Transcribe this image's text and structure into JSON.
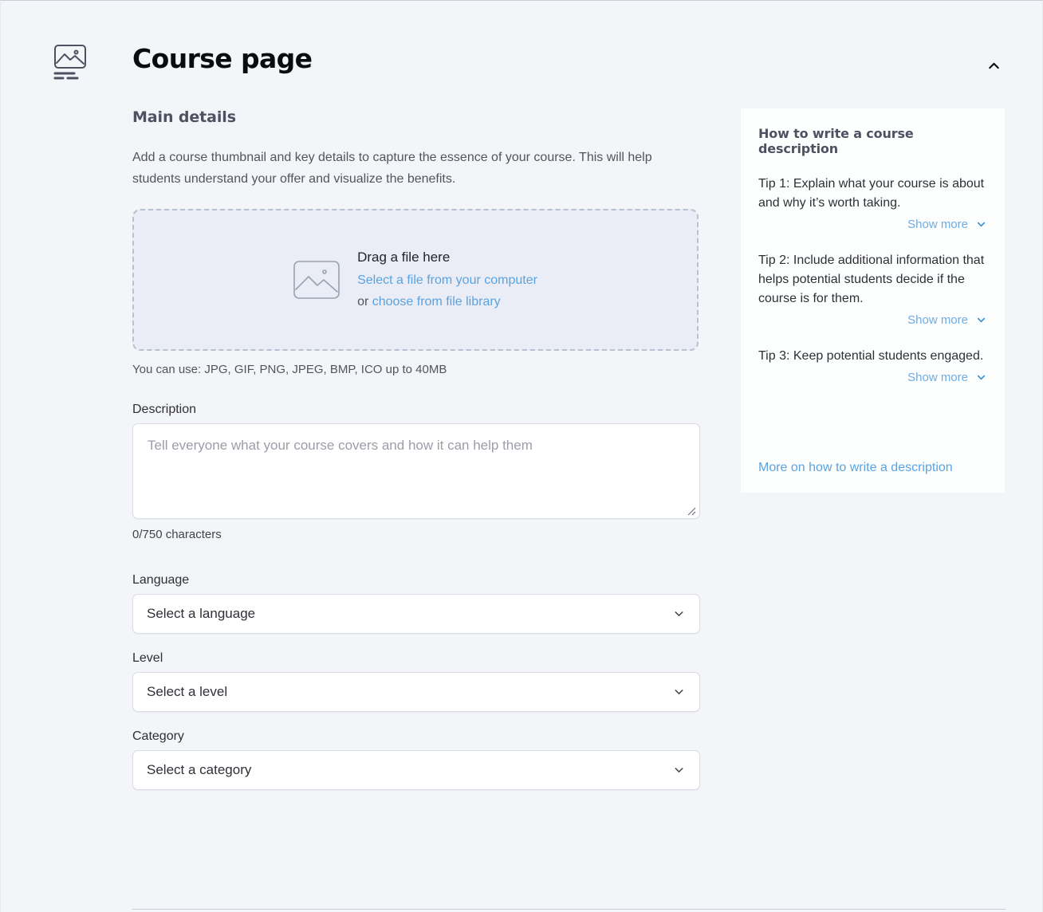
{
  "header": {
    "icon": "image-with-lines-icon",
    "title": "Course page",
    "collapse_icon": "chevron-up-icon"
  },
  "main": {
    "section_title": "Main details",
    "section_description": "Add a course thumbnail and key details to capture the essence of your course. This will help students understand your offer and visualize the benefits.",
    "dropzone": {
      "icon": "image-placeholder-icon",
      "title": "Drag a file here",
      "link_primary": "Select a file from your computer",
      "or_prefix": "or ",
      "link_secondary": "choose from file library",
      "hint": "You can use: JPG, GIF, PNG, JPEG, BMP, ICO up to 40MB"
    },
    "description": {
      "label": "Description",
      "placeholder": "Tell everyone what your course covers and how it can help them",
      "value": "",
      "char_count": "0/750 characters"
    },
    "fields": [
      {
        "label": "Language",
        "value": "Select a language",
        "caret": "chevron-down-icon"
      },
      {
        "label": "Level",
        "value": "Select a level",
        "caret": "chevron-down-icon"
      },
      {
        "label": "Category",
        "value": "Select a category",
        "caret": "chevron-down-icon"
      }
    ]
  },
  "tips": {
    "title": "How to write a course description",
    "items": [
      {
        "text": "Tip 1: Explain what your course is about and why it’s worth taking.",
        "show_more": "Show more"
      },
      {
        "text": "Tip 2: Include additional information that helps potential students decide if the course is for them.",
        "show_more": "Show more"
      },
      {
        "text": "Tip 3: Keep potential students engaged.",
        "show_more": "Show more"
      }
    ],
    "footer_link": "More on how to write a description"
  },
  "colors": {
    "background": "#f4f5f9",
    "card": "#fdfefe",
    "link": "#5ba3e0",
    "dropzone_bg": "#eaedf5",
    "heading": "#4d5161"
  }
}
